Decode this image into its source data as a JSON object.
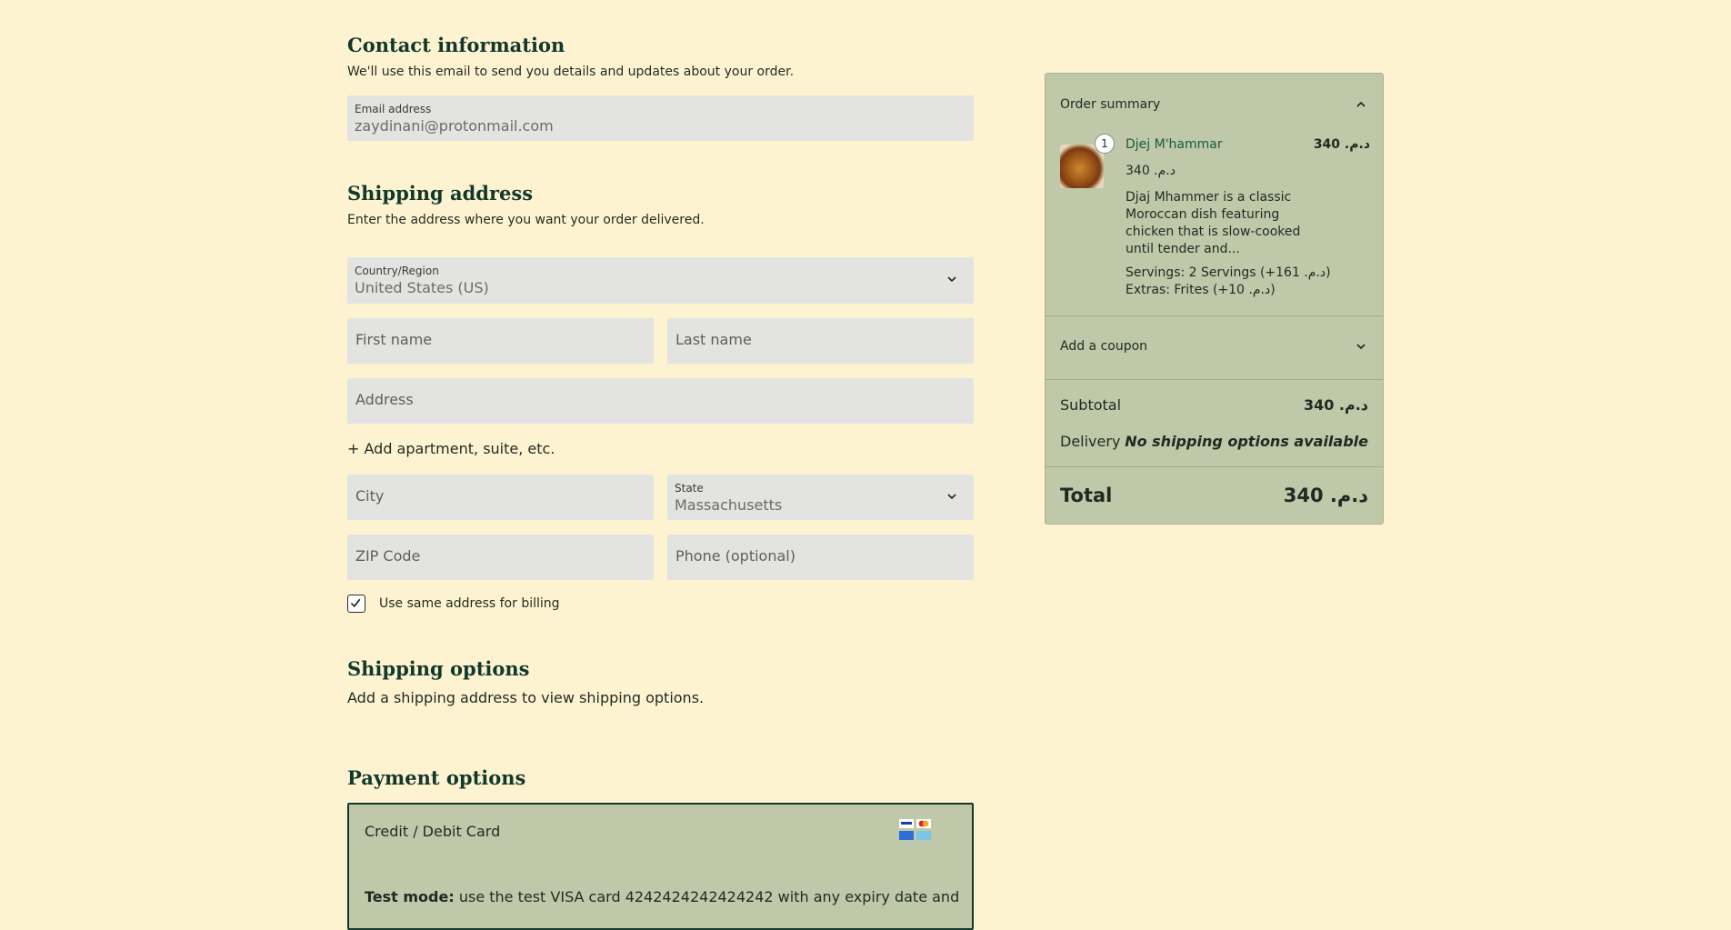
{
  "contact": {
    "heading": "Contact information",
    "description": "We'll use this email to send you details and updates about your order.",
    "email_label": "Email address",
    "email_value": "zaydinani@protonmail.com"
  },
  "shipping": {
    "heading": "Shipping address",
    "description": "Enter the address where you want your order delivered.",
    "country_label": "Country/Region",
    "country_value": "United States (US)",
    "first_name_placeholder": "First name",
    "last_name_placeholder": "Last name",
    "address_placeholder": "Address",
    "add_apartment": "+ Add apartment, suite, etc.",
    "city_placeholder": "City",
    "state_label": "State",
    "state_value": "Massachusetts",
    "zip_placeholder": "ZIP Code",
    "phone_placeholder": "Phone (optional)",
    "billing_checkbox_label": "Use same address for billing",
    "billing_checked": true
  },
  "shipping_options": {
    "heading": "Shipping options",
    "description": "Add a shipping address to view shipping options."
  },
  "payment": {
    "heading": "Payment options",
    "method_title": "Credit / Debit Card",
    "test_mode_label": "Test mode:",
    "test_mode_text": "use the test VISA card 4242424242424242 with any expiry date and"
  },
  "summary": {
    "heading": "Order summary",
    "product": {
      "quantity": "1",
      "name": "Djej M'hammar",
      "line_total": "340 .د.م",
      "unit_price": "340 .د.م",
      "description": "Djaj Mhammer is a classic Moroccan dish featuring chicken that is slow-cooked until tender and...",
      "option_servings": "Servings: 2 Servings (+161 .د.م)",
      "option_extras": "Extras: Frites (+10 .د.م)"
    },
    "coupon_label": "Add a coupon",
    "subtotal_label": "Subtotal",
    "subtotal_value": "340 .د.م",
    "delivery_label": "Delivery",
    "delivery_value": "No shipping options available",
    "total_label": "Total",
    "total_value": "340 .د.م"
  },
  "colors": {
    "page_bg": "#fef3d1",
    "panel_bg": "#bfc8a8",
    "heading": "#12382c",
    "field_bg": "#e3e3e1"
  }
}
